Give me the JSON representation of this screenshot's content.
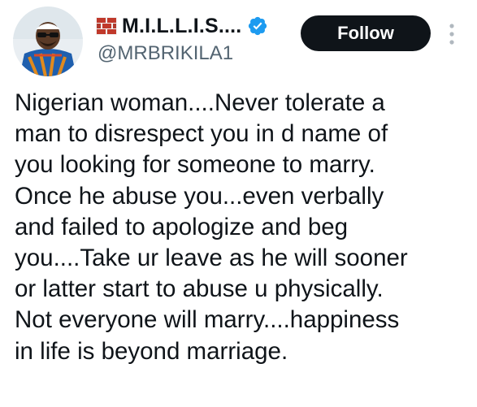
{
  "author": {
    "display_name": "M.I.L.L.I.S....",
    "handle": "@MRBRIKILA1",
    "name_prefix_icon": "brick-wall-icon",
    "verified_icon": "verified-badge-icon"
  },
  "actions": {
    "follow_label": "Follow",
    "more_icon": "more-options-icon"
  },
  "tweet": {
    "lines": [
      "Nigerian woman....Never tolerate a",
      "man to disrespect you in d name of",
      "you looking for someone to marry.",
      "Once he abuse you...even verbally",
      "and failed to apologize and beg",
      "you....Take ur leave as he will sooner",
      "or latter start to abuse u physically.",
      "Not everyone will marry....happiness",
      "in life is beyond marriage."
    ]
  },
  "colors": {
    "text": "#0f1419",
    "secondary_text": "#536471",
    "follow_bg": "#0f1419",
    "follow_text": "#ffffff",
    "verified": "#1d9bf0",
    "brick": "#c0392b"
  }
}
